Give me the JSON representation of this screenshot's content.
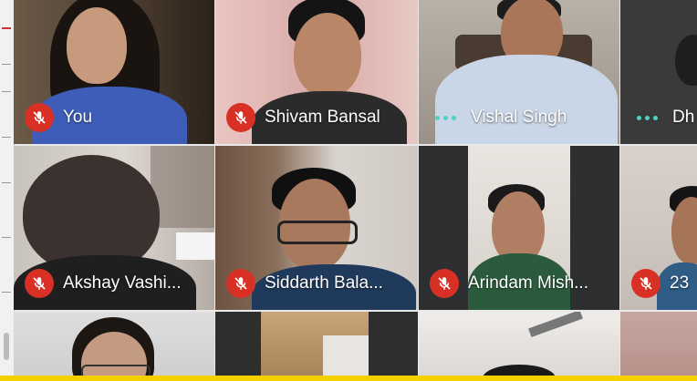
{
  "participants": [
    {
      "name": "You",
      "audio": "muted"
    },
    {
      "name": "Shivam Bansal",
      "audio": "muted"
    },
    {
      "name": "Vishal Singh",
      "audio": "speaking"
    },
    {
      "name": "Dh",
      "audio": "speaking"
    },
    {
      "name": "Akshay Vashi...",
      "audio": "muted"
    },
    {
      "name": "Siddarth Bala...",
      "audio": "muted"
    },
    {
      "name": "Arindam Mish...",
      "audio": "muted"
    },
    {
      "name": "23",
      "audio": "muted"
    }
  ],
  "icons": {
    "muted": "mic-off-icon",
    "speaking": "audio-dots-icon"
  },
  "colors": {
    "mute_red": "#d93025",
    "speaking_dots": "#4fd1c5",
    "bottom_bar": "#f4d000"
  }
}
